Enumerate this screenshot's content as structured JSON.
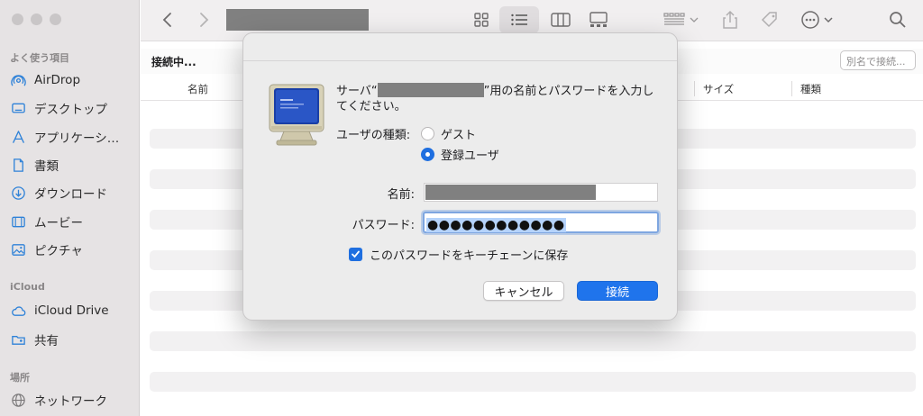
{
  "sidebar": {
    "sections": [
      {
        "label": "よく使う項目"
      },
      {
        "label": "iCloud"
      },
      {
        "label": "場所"
      }
    ],
    "items": [
      {
        "label": "AirDrop",
        "icon": "airdrop-icon"
      },
      {
        "label": "デスクトップ",
        "icon": "desktop-icon"
      },
      {
        "label": "アプリケーシ…",
        "icon": "applications-icon"
      },
      {
        "label": "書類",
        "icon": "document-icon"
      },
      {
        "label": "ダウンロード",
        "icon": "download-icon"
      },
      {
        "label": "ムービー",
        "icon": "movie-icon"
      },
      {
        "label": "ピクチャ",
        "icon": "picture-icon"
      },
      {
        "label": "iCloud Drive",
        "icon": "cloud-icon"
      },
      {
        "label": "共有",
        "icon": "shared-folder-icon"
      },
      {
        "label": "ネットワーク",
        "icon": "network-icon"
      }
    ]
  },
  "location": {
    "title": "接続中...",
    "search_placeholder": "別名で接続..."
  },
  "columns": [
    "名前",
    "サイズ",
    "種類"
  ],
  "dialog": {
    "message_prefix": "サーバ“",
    "message_suffix": "”用の名前とパスワードを入力してください。",
    "user_type_label": "ユーザの種類:",
    "guest_label": "ゲスト",
    "registered_label": "登録ユーザ",
    "name_label": "名前:",
    "password_label": "パスワード:",
    "password_mask": "●●●●●●●●●●●●",
    "save_label": "このパスワードをキーチェーンに保存",
    "cancel_label": "キャンセル",
    "connect_label": "接続"
  },
  "colors": {
    "accent": "#1f74ec"
  }
}
